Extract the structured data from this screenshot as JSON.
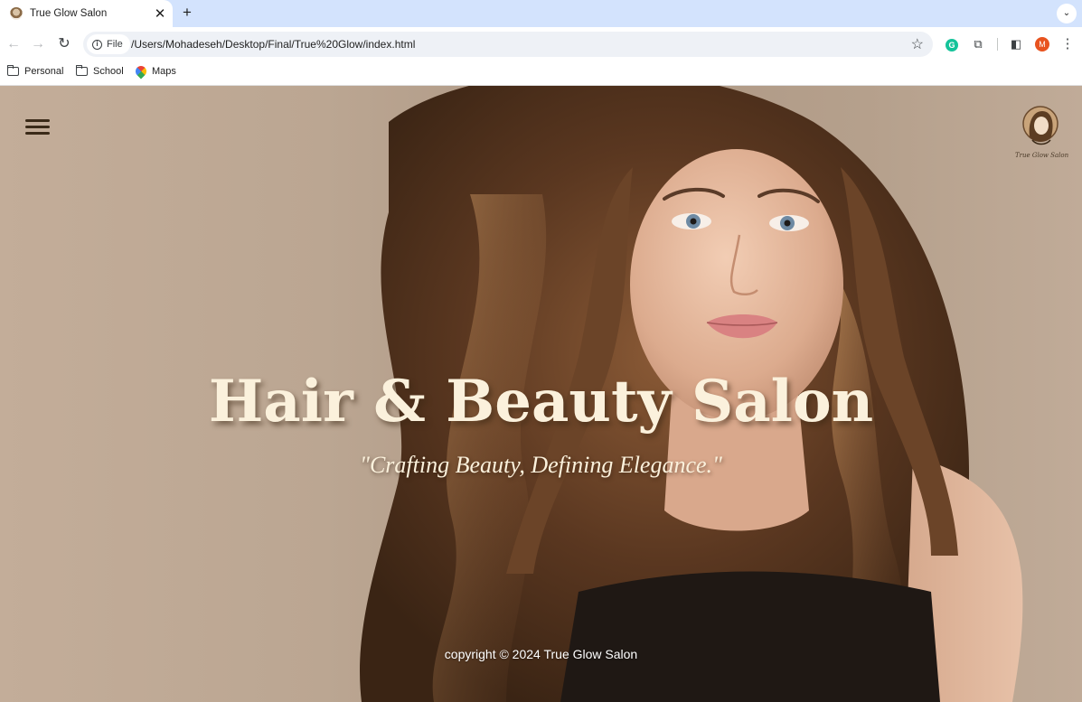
{
  "browser": {
    "tab": {
      "title": "True Glow Salon",
      "close_glyph": "✕"
    },
    "new_tab_glyph": "+",
    "tab_search_glyph": "⌄",
    "nav": {
      "back_glyph": "←",
      "forward_glyph": "→",
      "reload_glyph": "↻"
    },
    "address": {
      "scheme_chip": "File",
      "url": "/Users/Mohadeseh/Desktop/Final/True%20Glow/index.html"
    },
    "bookmark_star_glyph": "☆",
    "extensions": {
      "grammarly_glyph": "G",
      "puzzle_glyph": "⧉",
      "sidepanel_glyph": "◧"
    },
    "profile_initial": "M",
    "menu_glyph": "⋮",
    "bookmarks": [
      {
        "label": "Personal",
        "icon": "folder-icon"
      },
      {
        "label": "School",
        "icon": "folder-icon"
      },
      {
        "label": "Maps",
        "icon": "maps-icon"
      }
    ]
  },
  "page": {
    "hero": {
      "title": "Hair & Beauty Salon",
      "tagline": "\"Crafting Beauty, Defining Elegance.\""
    },
    "logo": {
      "caption": "True Glow Salon",
      "icon": "woman-portrait-logo"
    },
    "menu_icon": "hamburger-menu-icon",
    "footer": {
      "copyright": "copyright © 2024 True Glow Salon"
    }
  },
  "colors": {
    "tab_strip": "#d3e3fd",
    "hero_text": "#fbf1dc",
    "background_beige": "#bba692",
    "hamburger": "#3a2a18"
  }
}
